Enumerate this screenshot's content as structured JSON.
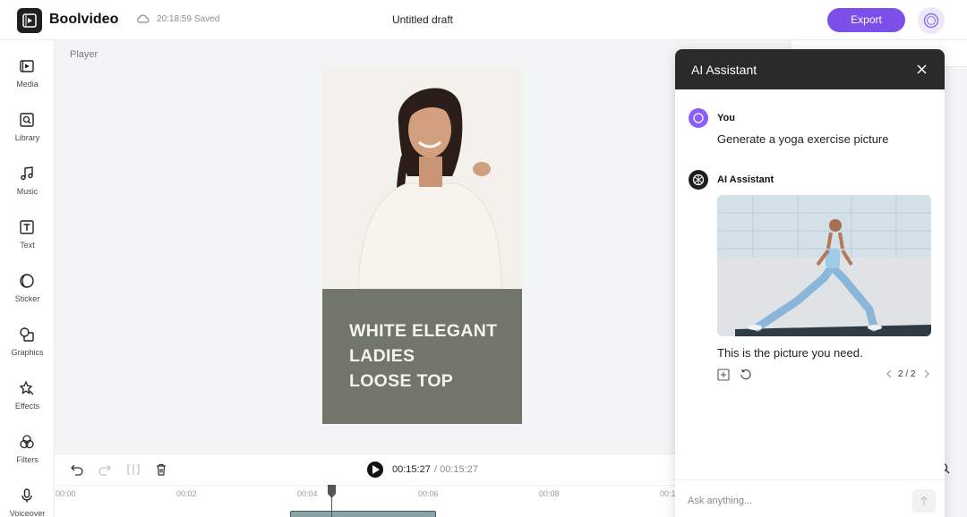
{
  "app": {
    "brand": "Boolvideo",
    "save_time": "20:18:59",
    "save_status": "Saved",
    "doc_title": "Untitled draft",
    "export_label": "Export",
    "accent_color": "#7b4fe8"
  },
  "sidebar": {
    "items": [
      {
        "label": "Media",
        "icon": "media-icon"
      },
      {
        "label": "Library",
        "icon": "library-icon"
      },
      {
        "label": "Music",
        "icon": "music-icon"
      },
      {
        "label": "Text",
        "icon": "text-icon"
      },
      {
        "label": "Sticker",
        "icon": "sticker-icon"
      },
      {
        "label": "Graphics",
        "icon": "graphics-icon"
      },
      {
        "label": "Effects",
        "icon": "effects-icon"
      },
      {
        "label": "Filters",
        "icon": "filters-icon"
      },
      {
        "label": "Voiceover",
        "icon": "voiceover-icon"
      }
    ]
  },
  "player": {
    "label": "Player",
    "caption_lines": [
      "WHITE ELEGANT",
      "LADIES",
      "LOOSE TOP"
    ]
  },
  "timeline": {
    "current_time": "00:15:27",
    "total_time": "/ 00:15:27",
    "ticks": [
      "00:00",
      "00:02",
      "00:04",
      "00:06",
      "00:08",
      "00:1"
    ]
  },
  "ai_assistant": {
    "title": "AI Assistant",
    "user_name": "You",
    "user_message": "Generate a yoga exercise picture",
    "assistant_name": "AI Assistant",
    "assistant_message": "This is the picture you need.",
    "pager": "2 / 2",
    "input_placeholder": "Ask anything..."
  }
}
